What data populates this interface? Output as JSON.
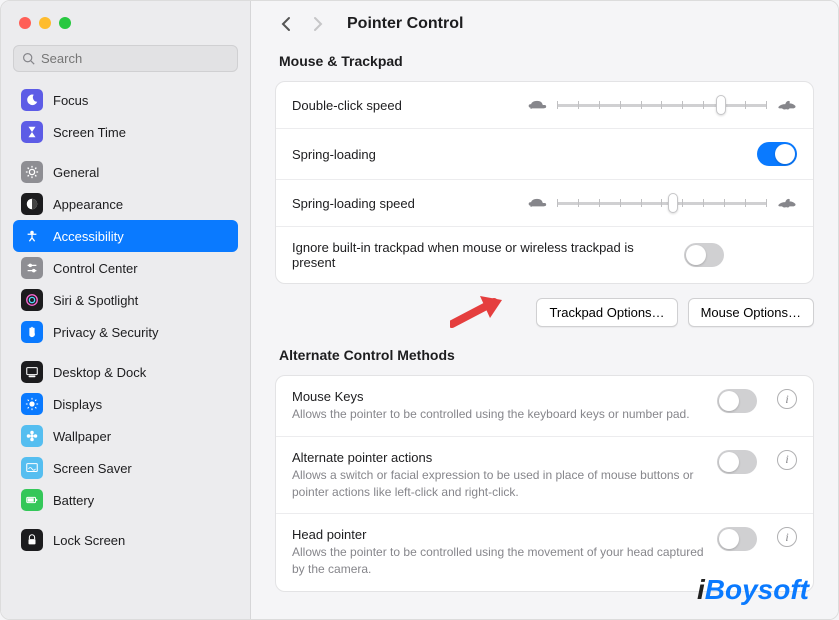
{
  "search": {
    "placeholder": "Search"
  },
  "sidebar": {
    "items": [
      {
        "label": "Focus",
        "icon": "moon",
        "bg": "#5d5ce6"
      },
      {
        "label": "Screen Time",
        "icon": "hourglass",
        "bg": "#5d5ce6"
      },
      {
        "sep": true
      },
      {
        "label": "General",
        "icon": "gear",
        "bg": "#8e8e93"
      },
      {
        "label": "Appearance",
        "icon": "appearance",
        "bg": "#1c1c1e"
      },
      {
        "label": "Accessibility",
        "icon": "accessibility",
        "bg": "#0a7aff",
        "selected": true
      },
      {
        "label": "Control Center",
        "icon": "controls",
        "bg": "#8e8e93"
      },
      {
        "label": "Siri & Spotlight",
        "icon": "siri",
        "bg": "#1c1c1e"
      },
      {
        "label": "Privacy & Security",
        "icon": "hand",
        "bg": "#0a7aff"
      },
      {
        "sep": true
      },
      {
        "label": "Desktop & Dock",
        "icon": "dock",
        "bg": "#1c1c1e"
      },
      {
        "label": "Displays",
        "icon": "brightness",
        "bg": "#0a7aff"
      },
      {
        "label": "Wallpaper",
        "icon": "flower",
        "bg": "#55bef0"
      },
      {
        "label": "Screen Saver",
        "icon": "screensaver",
        "bg": "#55bef0"
      },
      {
        "label": "Battery",
        "icon": "battery",
        "bg": "#34c759"
      },
      {
        "sep": true
      },
      {
        "label": "Lock Screen",
        "icon": "lock",
        "bg": "#1c1c1e"
      }
    ]
  },
  "header": {
    "title": "Pointer Control"
  },
  "section1": {
    "title": "Mouse & Trackpad",
    "rows": {
      "dblclick": {
        "label": "Double-click speed",
        "value": 0.78
      },
      "spring": {
        "label": "Spring-loading",
        "on": true
      },
      "springspeed": {
        "label": "Spring-loading speed",
        "value": 0.55
      },
      "ignore": {
        "label": "Ignore built-in trackpad when mouse or wireless trackpad is present",
        "on": false
      }
    },
    "buttons": {
      "trackpad": "Trackpad Options…",
      "mouse": "Mouse Options…"
    }
  },
  "section2": {
    "title": "Alternate Control Methods",
    "rows": {
      "mousekeys": {
        "label": "Mouse Keys",
        "desc": "Allows the pointer to be controlled using the keyboard keys or number pad.",
        "on": false
      },
      "altpointer": {
        "label": "Alternate pointer actions",
        "desc": "Allows a switch or facial expression to be used in place of mouse buttons or pointer actions like left-click and right-click.",
        "on": false
      },
      "headpointer": {
        "label": "Head pointer",
        "desc": "Allows the pointer to be controlled using the movement of your head captured by the camera.",
        "on": false
      }
    }
  },
  "watermark": "iBoysoft"
}
